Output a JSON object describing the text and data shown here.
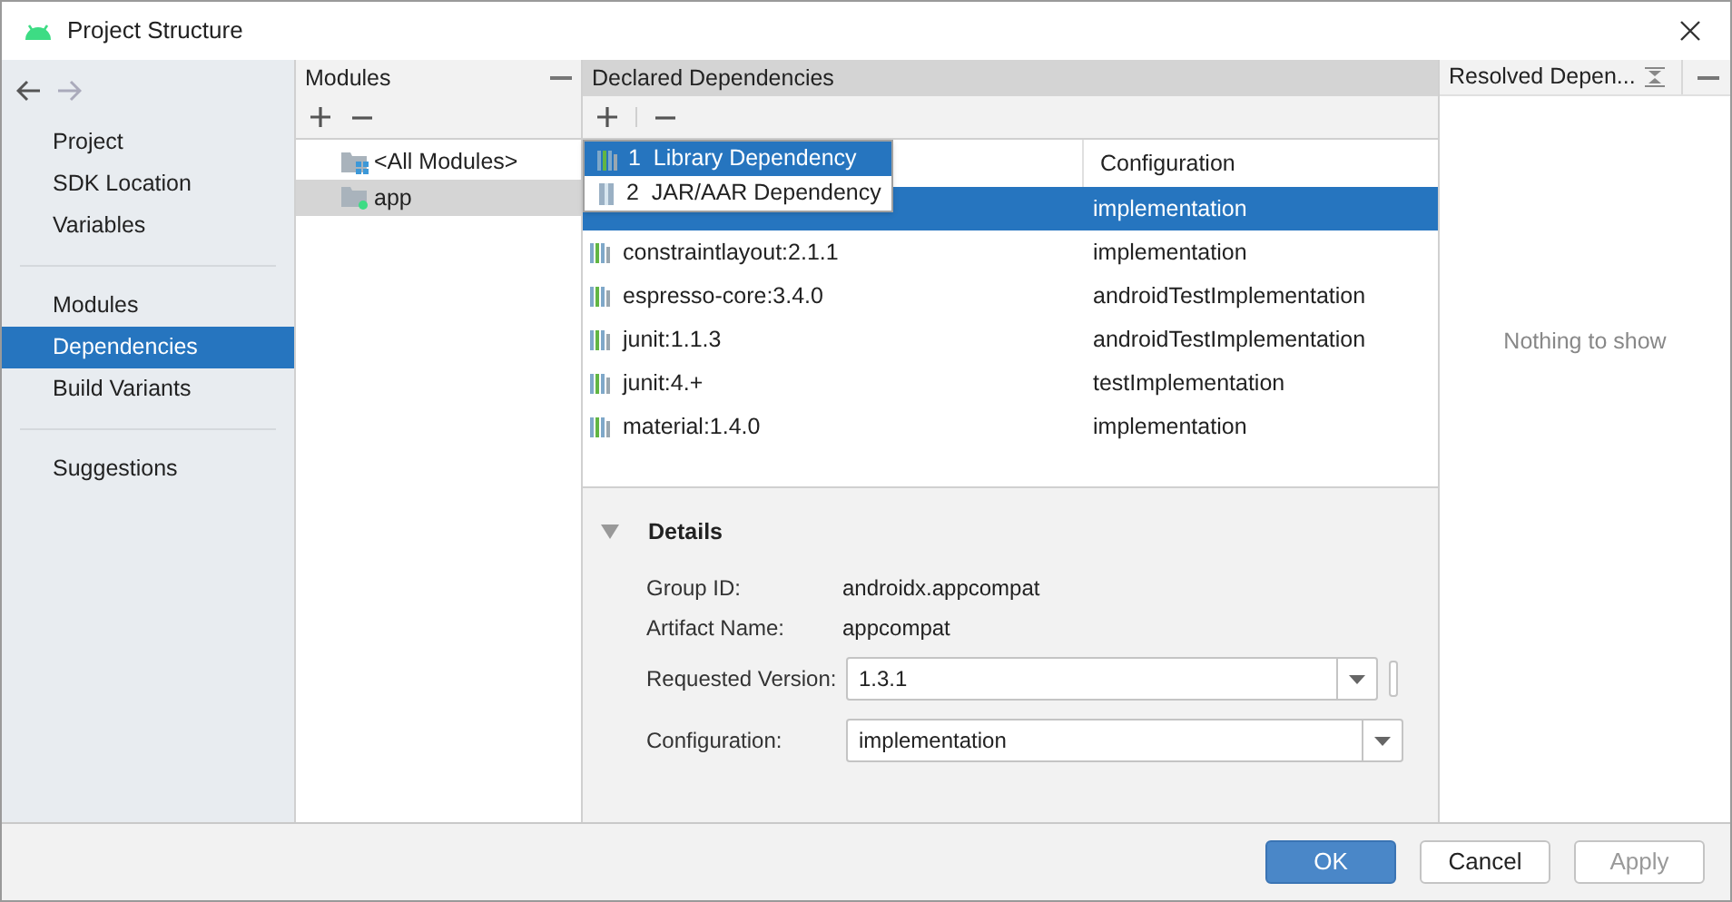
{
  "window": {
    "title": "Project Structure"
  },
  "sidebar": {
    "groups": [
      {
        "items": [
          {
            "label": "Project",
            "selected": false
          },
          {
            "label": "SDK Location",
            "selected": false
          },
          {
            "label": "Variables",
            "selected": false
          }
        ]
      },
      {
        "items": [
          {
            "label": "Modules",
            "selected": false
          },
          {
            "label": "Dependencies",
            "selected": true
          },
          {
            "label": "Build Variants",
            "selected": false
          }
        ]
      },
      {
        "items": [
          {
            "label": "Suggestions",
            "selected": false
          }
        ]
      }
    ]
  },
  "modules": {
    "title": "Modules",
    "items": [
      {
        "label": "<All Modules>",
        "kind": "all",
        "selected": false
      },
      {
        "label": "app",
        "kind": "module",
        "selected": true
      }
    ]
  },
  "declared": {
    "title": "Declared Dependencies",
    "add_menu": [
      {
        "number": "1",
        "label": "Library Dependency",
        "kind": "library",
        "selected": true
      },
      {
        "number": "2",
        "label": "JAR/AAR Dependency",
        "kind": "jar",
        "selected": false
      }
    ],
    "config_header": "Configuration",
    "rows": [
      {
        "configuration": "implementation",
        "selected": true
      },
      {
        "name": "constraintlayout:2.1.1",
        "configuration": "implementation",
        "selected": false
      },
      {
        "name": "espresso-core:3.4.0",
        "configuration": "androidTestImplementation",
        "selected": false
      },
      {
        "name": "junit:1.1.3",
        "configuration": "androidTestImplementation",
        "selected": false
      },
      {
        "name": "junit:4.+",
        "configuration": "testImplementation",
        "selected": false
      },
      {
        "name": "material:1.4.0",
        "configuration": "implementation",
        "selected": false
      }
    ]
  },
  "details": {
    "title": "Details",
    "expanded": true,
    "info": [
      {
        "label": "Group ID:",
        "value": "androidx.appcompat"
      },
      {
        "label": "Artifact Name:",
        "value": "appcompat"
      }
    ],
    "combos": [
      {
        "label": "Requested Version:",
        "value": "1.3.1",
        "extra": true
      },
      {
        "label": "Configuration:",
        "value": "implementation",
        "extra": false
      }
    ]
  },
  "resolved": {
    "title": "Resolved Depen...",
    "empty_text": "Nothing to show"
  },
  "buttons": [
    {
      "label": "OK",
      "kind": "primary",
      "disabled": false
    },
    {
      "label": "Cancel",
      "kind": "normal",
      "disabled": false
    },
    {
      "label": "Apply",
      "kind": "normal",
      "disabled": true
    }
  ]
}
